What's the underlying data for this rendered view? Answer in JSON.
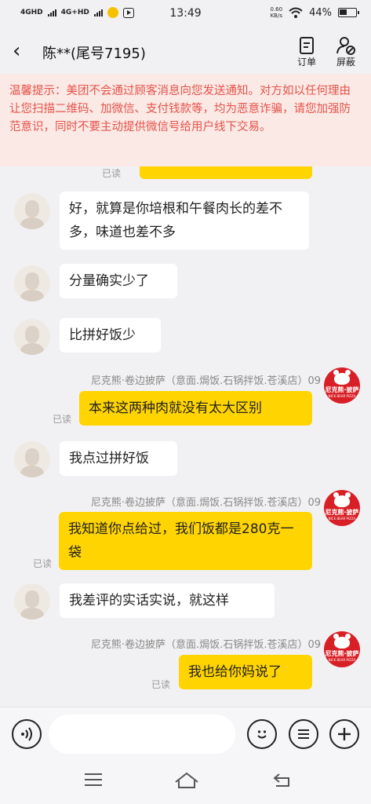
{
  "status": {
    "net1": "4GHD",
    "net2": "4G+HD",
    "time": "13:49",
    "speed_value": "0.60",
    "speed_unit": "KB/s",
    "battery": "44%"
  },
  "header": {
    "back_glyph": "‹",
    "title": "陈**(尾号7195)",
    "order_label": "订单",
    "block_label": "屏蔽"
  },
  "notice": "温馨提示：美团不会通过顾客消息向您发送通知。对方如以任何理由让您扫描二维码、加微信、支付钱款等，均为恶意诈骗，请您加强防范意识，同时不要主动提供微信号给用户线下交易。",
  "read_label": "已读",
  "shop_label": "尼克熊·卷边披萨（意面.焗饭.石锅拌饭.苍溪店）09",
  "shop_logo": {
    "title": "尼克熊·披萨",
    "sub": "NICK BEAR PIZZA"
  },
  "messages": [
    {
      "text": "好，就算是你培根和午餐肉长的差不多，味道也差不多"
    },
    {
      "text": "分量确实少了"
    },
    {
      "text": "比拼好饭少"
    },
    {
      "text": "本来这两种肉就没有太大区别"
    },
    {
      "text": "我点过拼好饭"
    },
    {
      "text": "我知道你点给过，我们饭都是280克一袋"
    },
    {
      "text": "我差评的实话实说，就这样"
    },
    {
      "text": "我也给你妈说了"
    }
  ],
  "colors": {
    "outgoing_bubble": "#ffd400",
    "notice_text": "#e5534b",
    "notice_bg": "#fbe9e5"
  }
}
